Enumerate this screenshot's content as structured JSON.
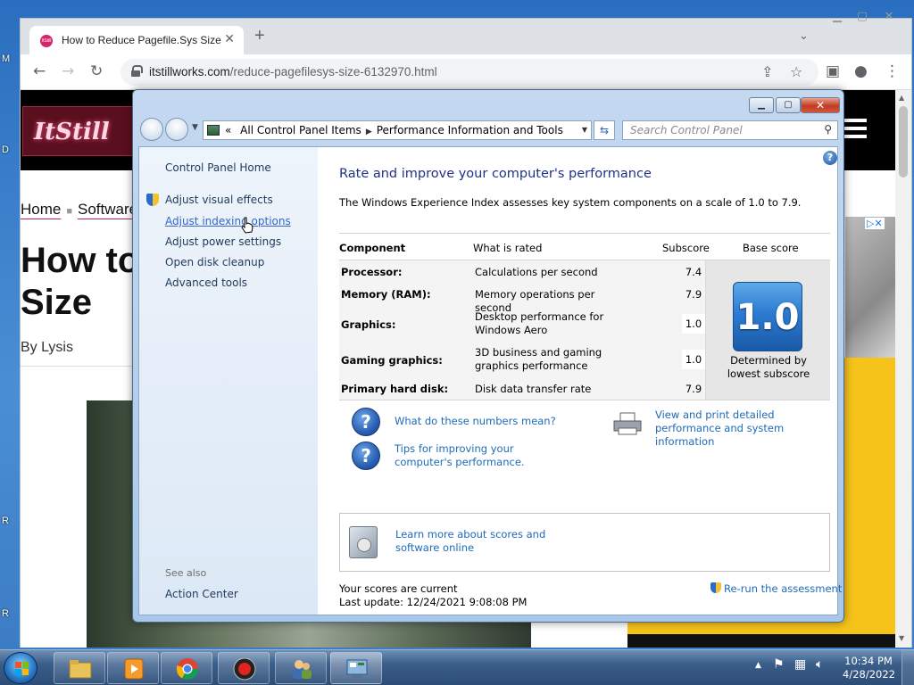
{
  "desktop": {
    "edge_letters": [
      "M",
      "D",
      "R",
      "R"
    ]
  },
  "browser": {
    "tab": {
      "title": "How to Reduce Pagefile.Sys Size",
      "favicon_text": "ItStill",
      "close": "✕"
    },
    "new_tab": "+",
    "tab_search": "⌄",
    "toolbar": {
      "back": "←",
      "forward": "→",
      "reload": "↻",
      "url_host": "itstillworks.com",
      "url_path": "/reduce-pagefilesys-size-6132970.html",
      "share": "⇪",
      "bookmark": "☆",
      "sidepanel": "▣",
      "profile": "●",
      "menu": "⋮"
    }
  },
  "webpage": {
    "logo_text": "ItStill",
    "breadcrumb": [
      "Home",
      "Software"
    ],
    "title": "How to\nSize",
    "byline": "By Lysis",
    "ad_icons": "▷✕"
  },
  "control_panel": {
    "breadcrumb_prefix": "«",
    "breadcrumb": [
      "All Control Panel Items",
      "Performance Information and Tools"
    ],
    "search_placeholder": "Search Control Panel",
    "window_buttons": {
      "minimize": "▁",
      "maximize": "▢",
      "close": "✕"
    },
    "left_nav": {
      "home": "Control Panel Home",
      "links": [
        "Adjust visual effects",
        "Adjust indexing options",
        "Adjust power settings",
        "Open disk cleanup",
        "Advanced tools"
      ],
      "see_also_label": "See also",
      "see_also_links": [
        "Action Center"
      ]
    },
    "main": {
      "title": "Rate and improve your computer's performance",
      "description": "The Windows Experience Index assesses key system components on a scale of 1.0 to 7.9.",
      "columns": [
        "Component",
        "What is rated",
        "Subscore",
        "Base score"
      ],
      "rows": [
        {
          "component": "Processor:",
          "what": "Calculations per second",
          "subscore": "7.4"
        },
        {
          "component": "Memory (RAM):",
          "what": "Memory operations per second",
          "subscore": "7.9"
        },
        {
          "component": "Graphics:",
          "what": "Desktop performance for Windows Aero",
          "subscore": "1.0"
        },
        {
          "component": "Gaming graphics:",
          "what": "3D business and gaming graphics performance",
          "subscore": "1.0"
        },
        {
          "component": "Primary hard disk:",
          "what": "Disk data transfer rate",
          "subscore": "7.9"
        }
      ],
      "base_score": "1.0",
      "base_caption": "Determined by\nlowest subscore",
      "links": {
        "numbers_meaning": "What do these numbers mean?",
        "tips": "Tips for improving your computer's performance.",
        "view_print": "View and print detailed performance and system information",
        "learn_more": "Learn more about scores and software online"
      },
      "status_line1": "Your scores are current",
      "status_line2": "Last update: 12/24/2021 9:08:08 PM",
      "rerun": "Re-run the assessment"
    }
  },
  "taskbar": {
    "clock_time": "10:34 PM",
    "clock_date": "4/28/2022",
    "tray_arrow": "▲"
  }
}
